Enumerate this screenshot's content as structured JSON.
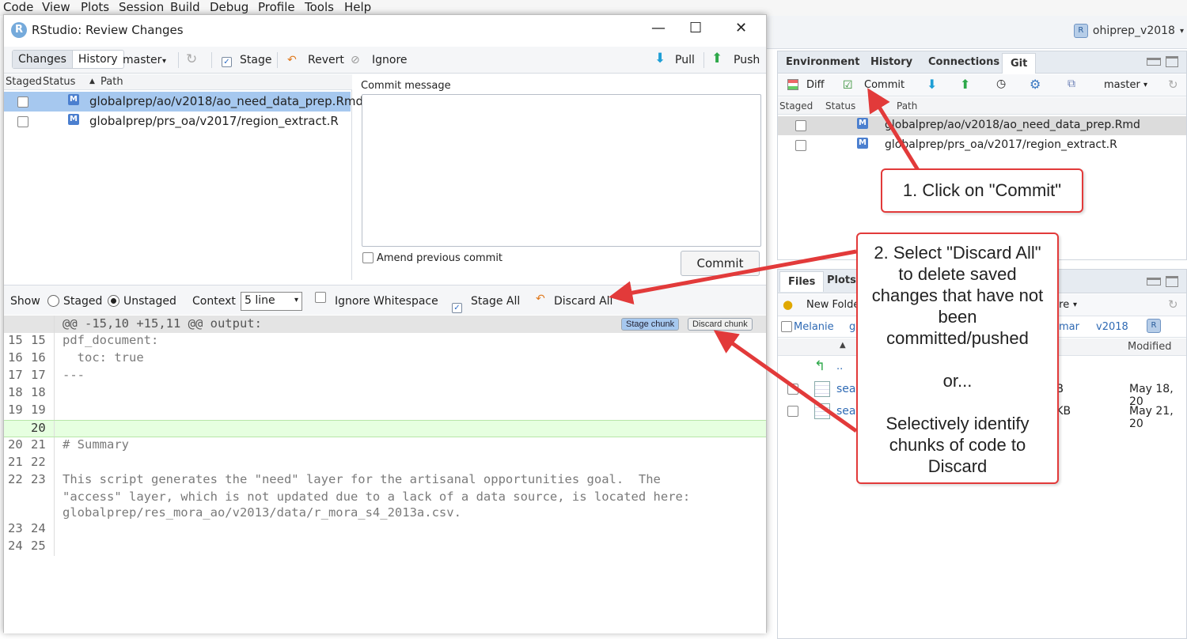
{
  "menubar": {
    "items": [
      "Code",
      "View",
      "Plots",
      "Session",
      "Build",
      "Debug",
      "Profile",
      "Tools",
      "Help"
    ]
  },
  "project": {
    "name": "ohiprep_v2018"
  },
  "right_pane": {
    "tabs": [
      "Environment",
      "History",
      "Connections",
      "Git"
    ],
    "toolbar": {
      "diff": "Diff",
      "commit": "Commit",
      "branch": "master"
    },
    "headers": {
      "staged": "Staged",
      "status": "Status",
      "path": "Path"
    },
    "files": [
      {
        "status": "M",
        "path": "globalprep/ao/v2018/ao_need_data_prep.Rmd"
      },
      {
        "status": "M",
        "path": "globalprep/prs_oa/v2017/region_extract.R"
      }
    ]
  },
  "files_pane": {
    "tabs": [
      "Files",
      "Plots"
    ],
    "new_folder": "New Folder",
    "more": "More",
    "breadcrumb": [
      "Melanie",
      "g",
      "mar",
      "v2018"
    ],
    "modified_header": "Modified",
    "rows": [
      {
        "name": "..",
        "size": "",
        "modified": ""
      },
      {
        "name": "sea",
        "size": "2 B",
        "modified": "May 18, 20"
      },
      {
        "name": "sea",
        "size": "2 KB",
        "modified": "May 21, 20"
      }
    ]
  },
  "window": {
    "title": "RStudio: Review Changes",
    "tabs": {
      "changes": "Changes",
      "history": "History"
    },
    "branch": "master",
    "toolbar": {
      "stage": "Stage",
      "revert": "Revert",
      "ignore": "Ignore",
      "pull": "Pull",
      "push": "Push"
    },
    "headers": {
      "staged": "Staged",
      "status": "Status",
      "path": "Path"
    },
    "files": [
      {
        "status": "M",
        "path": "globalprep/ao/v2018/ao_need_data_prep.Rmd"
      },
      {
        "status": "M",
        "path": "globalprep/prs_oa/v2017/region_extract.R"
      }
    ],
    "commit_label": "Commit message",
    "amend_label": "Amend previous commit",
    "commit_button": "Commit",
    "show": {
      "label": "Show",
      "staged": "Staged",
      "unstaged": "Unstaged",
      "context_label": "Context",
      "context_value": "5 line",
      "ignore_ws": "Ignore Whitespace",
      "stage_all": "Stage All",
      "discard_all": "Discard All"
    },
    "diff": {
      "hunk": "@@ -15,10 +15,11 @@ output:",
      "stage_chunk": "Stage chunk",
      "discard_chunk": "Discard chunk",
      "lines": [
        {
          "a": "15",
          "b": "15",
          "text": "pdf_document:",
          "added": false
        },
        {
          "a": "16",
          "b": "16",
          "text": "  toc: true",
          "added": false
        },
        {
          "a": "17",
          "b": "17",
          "text": "---",
          "added": false
        },
        {
          "a": "18",
          "b": "18",
          "text": "",
          "added": false
        },
        {
          "a": "19",
          "b": "19",
          "text": "",
          "added": false
        },
        {
          "a": "",
          "b": "20",
          "text": "",
          "added": true
        },
        {
          "a": "20",
          "b": "21",
          "text": "# Summary",
          "added": false
        },
        {
          "a": "21",
          "b": "22",
          "text": "",
          "added": false
        },
        {
          "a": "22",
          "b": "23",
          "text": "This script generates the \"need\" layer for the artisanal opportunities goal.  The",
          "added": false
        },
        {
          "a": "",
          "b": "",
          "text": "\"access\" layer, which is not updated due to a lack of a data source, is located here:",
          "added": false
        },
        {
          "a": "",
          "b": "",
          "text": "globalprep/res_mora_ao/v2013/data/r_mora_s4_2013a.csv.",
          "added": false
        },
        {
          "a": "23",
          "b": "24",
          "text": "",
          "added": false
        },
        {
          "a": "24",
          "b": "25",
          "text": "",
          "added": false
        }
      ]
    }
  },
  "callouts": {
    "one": "1. Click on \"Commit\"",
    "two_a": "2. Select \"Discard All\" to delete saved changes that have not been committed/pushed",
    "two_b": "or...",
    "two_c": "Selectively identify chunks of code to Discard"
  },
  "colors": {
    "accent": "#e23a3a",
    "selected_row": "#a6c8ef",
    "added_line": "#e6ffe0"
  }
}
